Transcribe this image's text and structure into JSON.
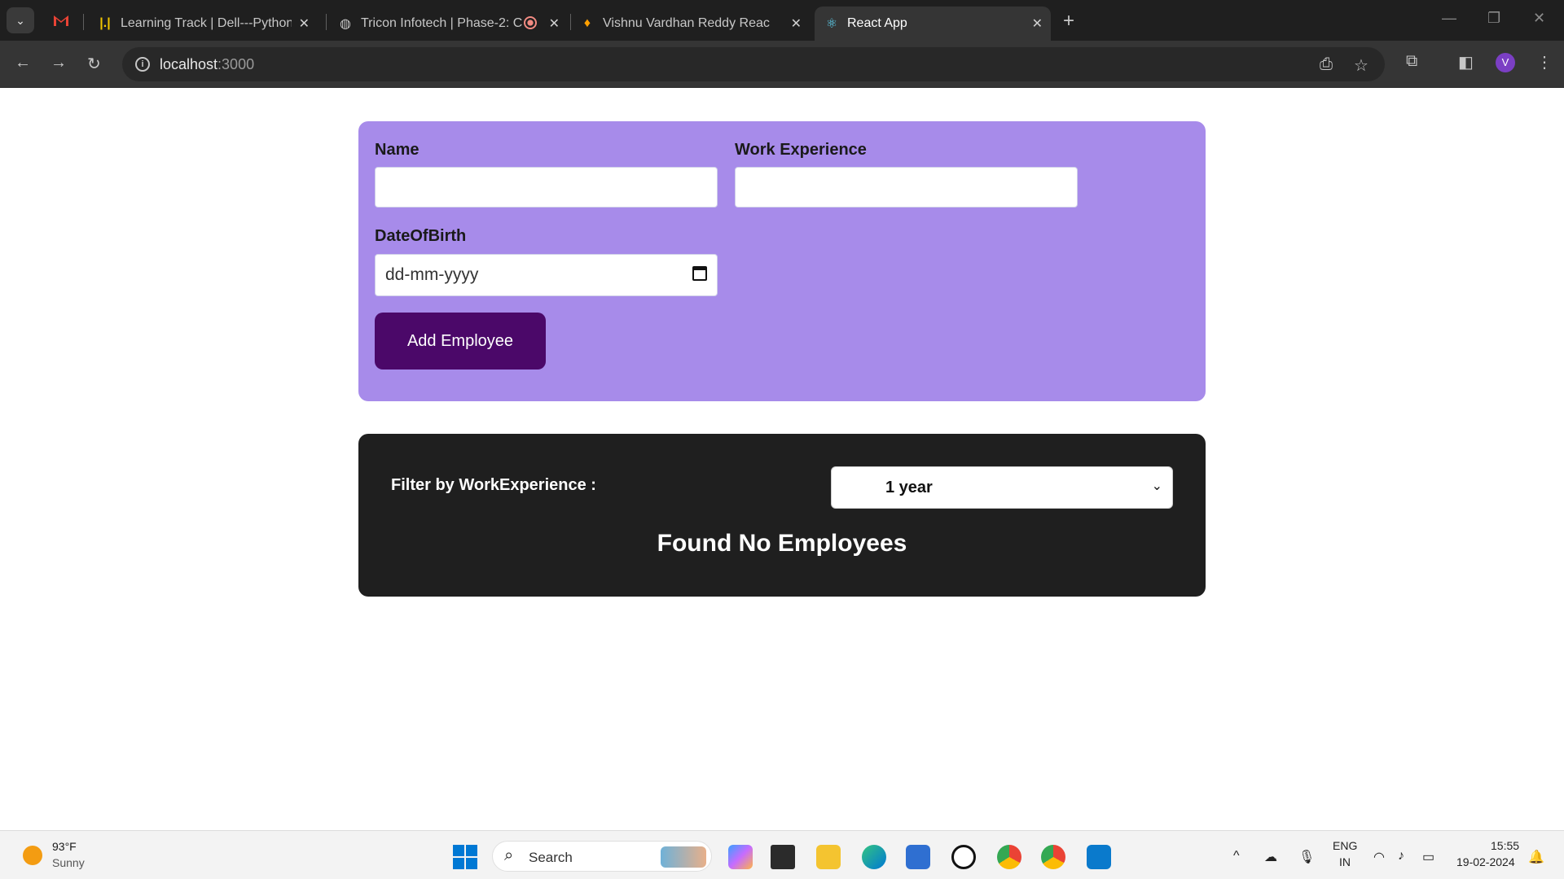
{
  "browser": {
    "tabs": [
      {
        "title": "Learning Track | Dell---Python-F",
        "active": false
      },
      {
        "title": "Tricon Infotech | Phase-2: C",
        "active": false
      },
      {
        "title": "Vishnu Vardhan Reddy ReactJS",
        "active": false
      },
      {
        "title": "React App",
        "active": true
      }
    ],
    "url_host": "localhost",
    "url_port": ":3000",
    "profile_initial": "V"
  },
  "form": {
    "name_label": "Name",
    "experience_label": "Work Experience",
    "dob_label": "DateOfBirth",
    "dob_placeholder": "dd-mm-yyyy",
    "add_button": "Add Employee"
  },
  "filter": {
    "label": "Filter by WorkExperience :",
    "selected": "1 year",
    "empty_message": "Found No Employees"
  },
  "taskbar": {
    "weather_temp": "93°F",
    "weather_desc": "Sunny",
    "search_placeholder": "Search",
    "lang_line1": "ENG",
    "lang_line2": "IN",
    "time": "15:55",
    "date": "19-02-2024"
  }
}
